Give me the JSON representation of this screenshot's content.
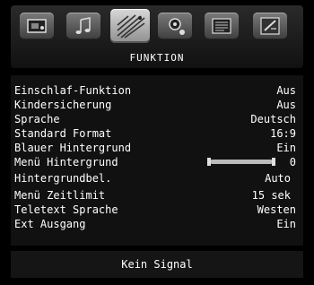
{
  "tabs": [
    {
      "icon": "picture-icon",
      "active": false
    },
    {
      "icon": "sound-icon",
      "active": false
    },
    {
      "icon": "function-icon",
      "active": true
    },
    {
      "icon": "setup-icon",
      "active": false
    },
    {
      "icon": "teletext-icon",
      "active": false
    },
    {
      "icon": "install-icon",
      "active": false
    }
  ],
  "section_title": "FUNKTION",
  "menu": {
    "items": [
      {
        "label": "Einschlaf-Funktion",
        "value": "Aus"
      },
      {
        "label": "Kindersicherung",
        "value": "Aus"
      },
      {
        "label": "Sprache",
        "value": "Deutsch"
      },
      {
        "label": "Standard Format",
        "value": "16:9"
      },
      {
        "label": "Blauer Hintergrund",
        "value": "Ein"
      },
      {
        "label": "Menü Hintergrund",
        "value": "0",
        "slider_fraction": 0.0
      },
      {
        "label": "Hintergrundbel.",
        "value": "Auto"
      },
      {
        "label": "Menü Zeitlimit",
        "value": "15 sek"
      },
      {
        "label": "Teletext Sprache",
        "value": "Westen"
      },
      {
        "label": "Ext Ausgang",
        "value": "Ein"
      }
    ]
  },
  "status": "Kein Signal",
  "colors": {
    "background": "#000000",
    "text": "#ffffff",
    "panel": "#111111"
  }
}
